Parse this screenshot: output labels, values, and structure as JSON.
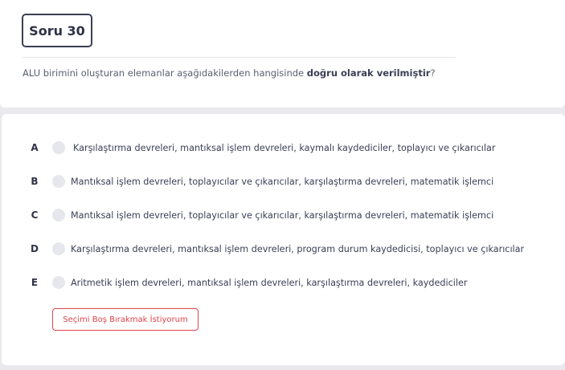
{
  "question": {
    "title": "Soru 30",
    "text_before": "ALU birimini oluşturan elemanlar aşağıdakilerden hangisinde ",
    "text_bold": "doğru olarak verilmiştir",
    "text_after": "?"
  },
  "options": [
    {
      "letter": "A",
      "text": "Karşılaştırma devreleri, mantıksal işlem devreleri, kaymalı kaydediciler, toplayıcı ve çıkarıcılar"
    },
    {
      "letter": "B",
      "text": "Mantıksal işlem devreleri, toplayıcılar ve çıkarıcılar, karşılaştırma devreleri, matematik işlemci"
    },
    {
      "letter": "C",
      "text": "Mantıksal işlem devreleri, toplayıcılar ve çıkarıcılar, karşılaştırma devreleri, matematik işlemci"
    },
    {
      "letter": "D",
      "text": "Karşılaştırma devreleri, mantıksal işlem devreleri, program durum kaydedicisi, toplayıcı ve çıkarıcılar"
    },
    {
      "letter": "E",
      "text": "Aritmetik işlem devreleri, mantıksal işlem devreleri, karşılaştırma devreleri, kaydediciler"
    }
  ],
  "clear_button_label": "Seçimi Boş Bırakmak İstiyorum",
  "colors": {
    "background": "#e9e9ee",
    "accent_red": "#e0434b",
    "text_dark": "#2e3347"
  }
}
